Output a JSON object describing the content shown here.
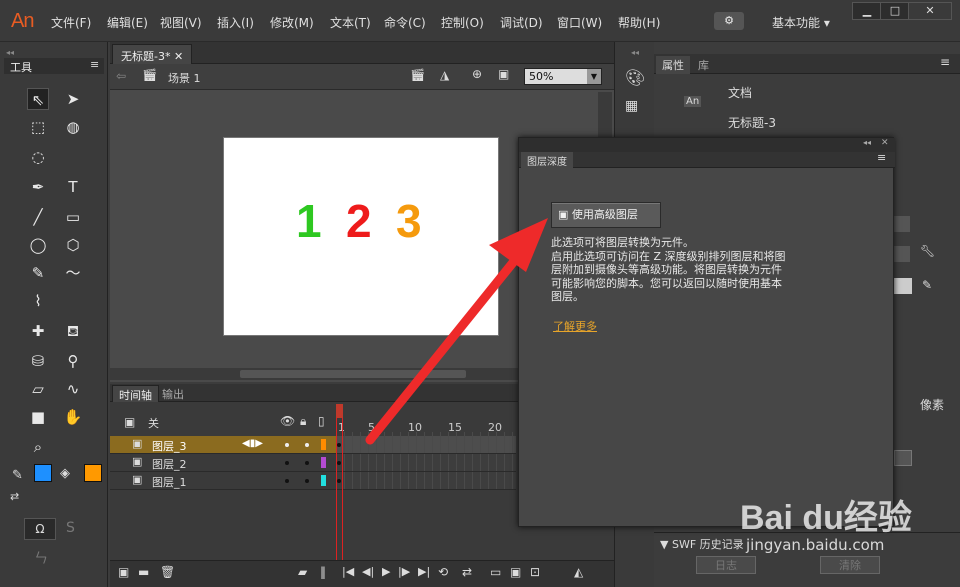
{
  "app": {
    "logo": "An"
  },
  "menu": [
    "文件(F)",
    "编辑(E)",
    "视图(V)",
    "插入(I)",
    "修改(M)",
    "文本(T)",
    "命令(C)",
    "控制(O)",
    "调试(D)",
    "窗口(W)",
    "帮助(H)"
  ],
  "workspace": {
    "label": "基本功能"
  },
  "window_controls": {
    "minimize": "▁",
    "maximize": "□",
    "close": "✕"
  },
  "tools_panel": {
    "title": "工具"
  },
  "doc": {
    "tab": "无标题-3*",
    "scene": "场景 1",
    "zoom": "50%"
  },
  "stage": {
    "numbers": [
      "1",
      "2",
      "3"
    ],
    "colors": [
      "#2ec821",
      "#ee1b1b",
      "#f59a0d"
    ]
  },
  "timeline": {
    "tab1": "时间轴",
    "tab2": "输出",
    "header_label": "关",
    "frame_numbers": [
      "1",
      "5",
      "10",
      "15",
      "20"
    ],
    "layers": [
      {
        "name": "图层_3",
        "color": "#ff8c00",
        "selected": true
      },
      {
        "name": "图层_2",
        "color": "#b44bd1",
        "selected": false
      },
      {
        "name": "图层_1",
        "color": "#22e0e0",
        "selected": false
      }
    ]
  },
  "properties": {
    "tab1": "属性",
    "tab2": "库",
    "doc_type": "文档",
    "doc_name": "无标题-3",
    "unit": "像素",
    "swf_history": "SWF 历史记录",
    "log_button": "日志",
    "clear_button": "清除"
  },
  "layer_depth": {
    "title": "图层深度",
    "button": "使用高级图层",
    "description": "此选项可将图层转换为元件。\n启用此选项可访问在 Z 深度级别排列图层和将图层附加到摄像头等高级功能。将图层转换为元件可能影响您的脚本。您可以返回以随时使用基本图层。",
    "learn_more": "了解更多"
  },
  "watermark": {
    "text": "Bai du经验",
    "url": "jingyan.baidu.com"
  }
}
